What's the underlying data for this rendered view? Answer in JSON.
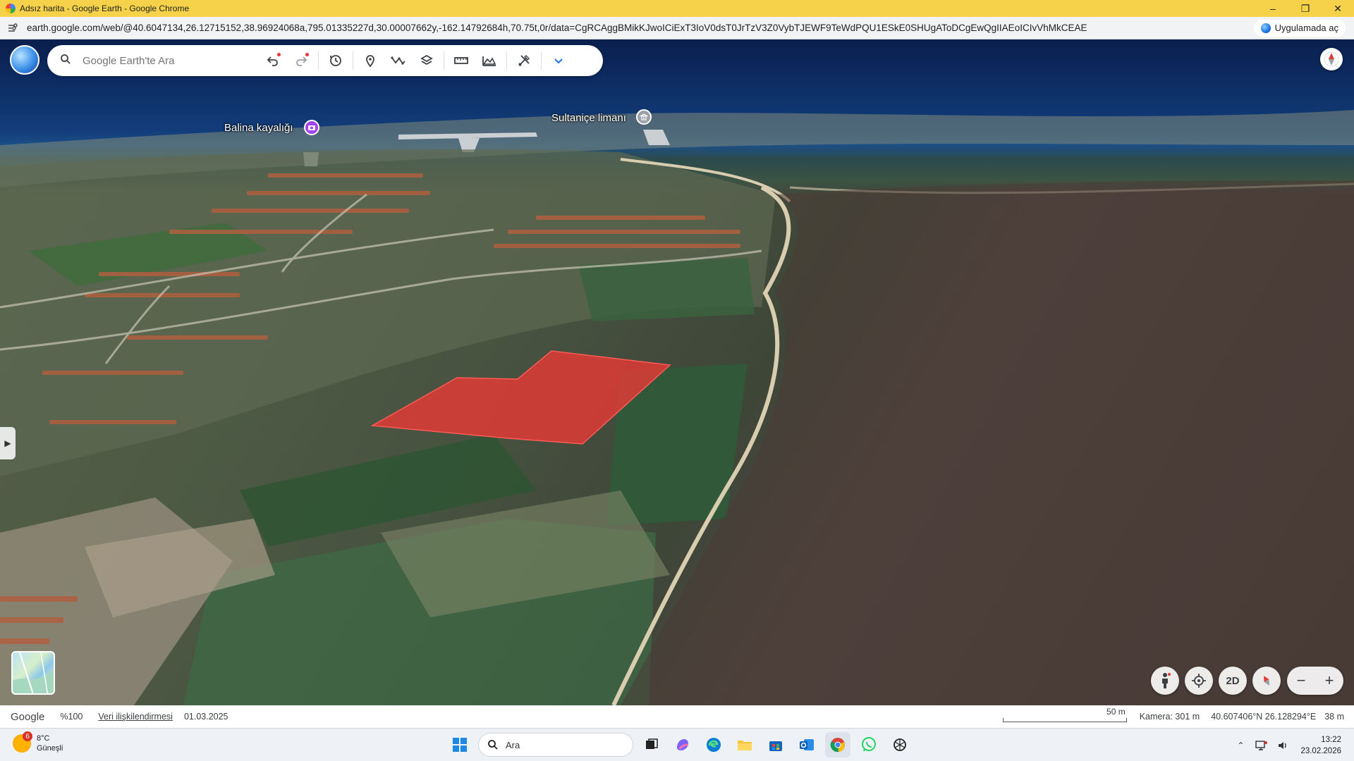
{
  "window": {
    "title": "Adsız harita - Google Earth - Google Chrome"
  },
  "address": {
    "url": "earth.google.com/web/@40.6047134,26.12715152,38.96924068a,795.01335227d,30.00007662y,-162.14792684h,70.75t,0r/data=CgRCAggBMikKJwoICiExT3IoV0dsT0JrTzV3Z0VybTJEWF9TeWdPQU1ESkE0SHUgAToDCgEwQgIIAEoICIvVhMkCEAE",
    "open_app_label": "Uygulamada aç"
  },
  "toolbar": {
    "search_placeholder": "Google Earth'te Ara",
    "tools": [
      {
        "name": "undo-icon"
      },
      {
        "name": "redo-icon"
      },
      {
        "name": "history-icon"
      },
      {
        "name": "placemark-icon"
      },
      {
        "name": "path-icon"
      },
      {
        "name": "layers-icon"
      },
      {
        "name": "ruler-icon"
      },
      {
        "name": "elevation-profile-icon"
      },
      {
        "name": "tools-icon"
      },
      {
        "name": "chevron-down-icon"
      }
    ]
  },
  "map": {
    "places": [
      {
        "label": "Balina kayalığı",
        "color": "#a142f4",
        "icon": "camera-icon"
      },
      {
        "label": "Sultaniçe limanı",
        "color": "#9aa0a6",
        "icon": "landmark-icon"
      }
    ],
    "polygon_color": "#e53935"
  },
  "controls": {
    "mode_2d": "2D"
  },
  "status": {
    "brand": "Google",
    "zoom": "%100",
    "data_attribution": "Veri ilişkilendirmesi",
    "imagery_date": "01.03.2025",
    "scale_label": "50 m",
    "camera": "Kamera: 301 m",
    "coordinates": "40.607406°N 26.128294°E",
    "elevation": "38 m"
  },
  "taskbar": {
    "weather_badge": "6",
    "temperature": "8°C",
    "condition": "Güneşli",
    "search_label": "Ara",
    "time": "13:22",
    "date": "23.02.2026"
  }
}
